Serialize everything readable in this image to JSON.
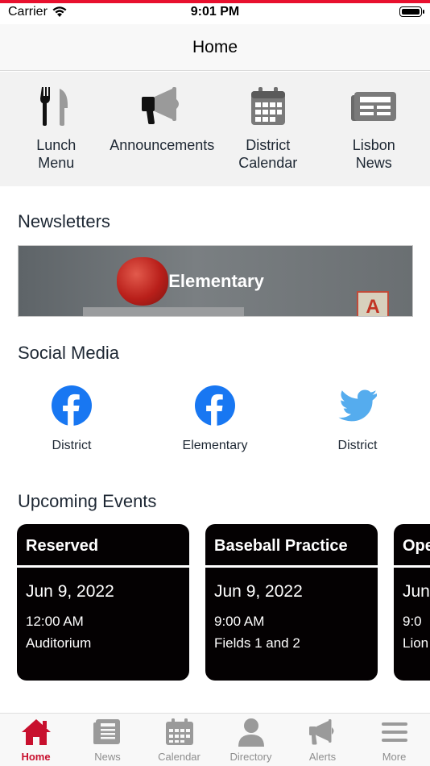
{
  "status_bar": {
    "carrier": "Carrier",
    "time": "9:01 PM"
  },
  "nav": {
    "title": "Home"
  },
  "quick_links": [
    {
      "label": "Lunch\nMenu",
      "icon": "fork-knife-icon"
    },
    {
      "label": "Announcements",
      "icon": "megaphone-icon"
    },
    {
      "label": "District\nCalendar",
      "icon": "calendar-icon"
    },
    {
      "label": "Lisbon\nNews",
      "icon": "newspaper-icon"
    }
  ],
  "newsletters": {
    "title": "Newsletters",
    "items": [
      {
        "label": "Elementary"
      }
    ]
  },
  "social_media": {
    "title": "Social Media",
    "items": [
      {
        "label": "District",
        "icon": "facebook-icon"
      },
      {
        "label": "Elementary",
        "icon": "facebook-icon"
      },
      {
        "label": "District",
        "icon": "twitter-icon"
      }
    ]
  },
  "upcoming_events": {
    "title": "Upcoming Events",
    "items": [
      {
        "title": "Reserved",
        "date": "Jun 9, 2022",
        "time": "12:00 AM",
        "location": "Auditorium"
      },
      {
        "title": "Baseball Practice",
        "date": "Jun 9, 2022",
        "time": "9:00 AM",
        "location": "Fields 1 and 2"
      },
      {
        "title": "Ope",
        "date": "Jun",
        "time": "9:0",
        "location": "Lion"
      }
    ]
  },
  "tabs": [
    {
      "label": "Home",
      "icon": "home-icon",
      "active": true
    },
    {
      "label": "News",
      "icon": "news-icon",
      "active": false
    },
    {
      "label": "Calendar",
      "icon": "calendar-icon",
      "active": false
    },
    {
      "label": "Directory",
      "icon": "person-icon",
      "active": false
    },
    {
      "label": "Alerts",
      "icon": "megaphone-icon",
      "active": false
    },
    {
      "label": "More",
      "icon": "menu-icon",
      "active": false
    }
  ],
  "colors": {
    "accent": "#c8102e",
    "status_line": "#e8102e",
    "facebook": "#1877f2",
    "twitter": "#55acee",
    "event_card": "#040102",
    "tab_inactive": "#8e8e8e"
  }
}
